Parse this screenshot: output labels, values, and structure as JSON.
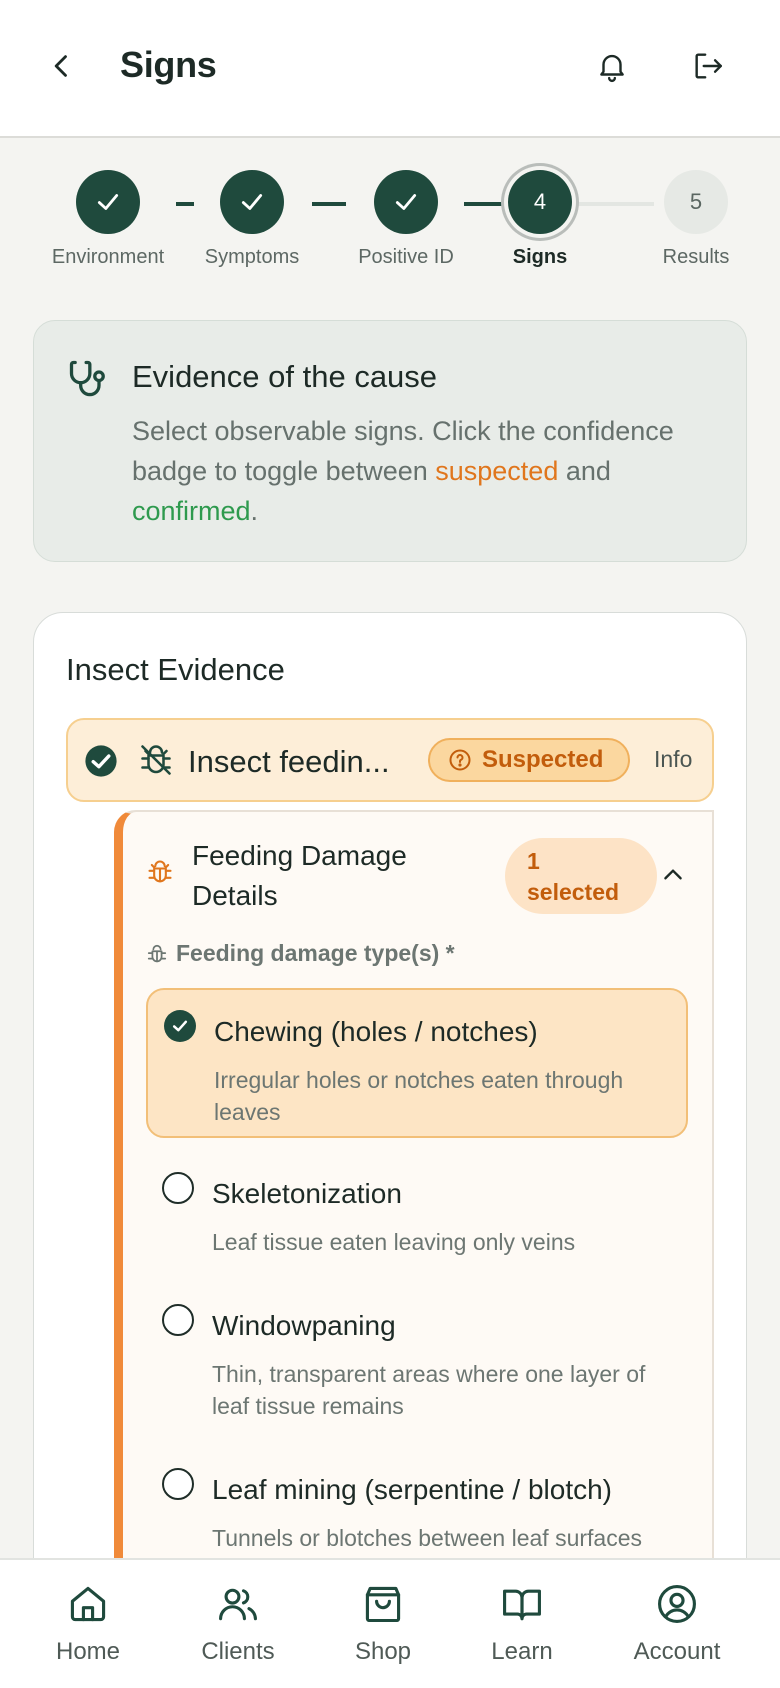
{
  "header": {
    "title": "Signs",
    "back_icon": "chevron-left-icon",
    "notification_icon": "bell-icon",
    "logout_icon": "logout-icon"
  },
  "stepper": {
    "steps": [
      {
        "label": "Environment",
        "state": "done",
        "number": ""
      },
      {
        "label": "Symptoms",
        "state": "done",
        "number": ""
      },
      {
        "label": "Positive ID",
        "state": "done",
        "number": ""
      },
      {
        "label": "Signs",
        "state": "current",
        "number": "4"
      },
      {
        "label": "Results",
        "state": "todo",
        "number": "5"
      }
    ]
  },
  "info": {
    "heading": "Evidence of the cause",
    "desc_before": "Select observable signs. Click the confidence badge to toggle between ",
    "suspected": "suspected",
    "and": " and ",
    "confirmed": "confirmed",
    "period": "."
  },
  "panel": {
    "title": "Insect Evidence",
    "evidence": {
      "label": "Insect feedin...",
      "badge": "Suspected",
      "info_link": "Info"
    },
    "details": {
      "title": "Feeding Damage Details",
      "count": "1 selected",
      "field_label": "Feeding damage type(s) *",
      "options": [
        {
          "name": "Chewing (holes / notches)",
          "desc": "Irregular holes or notches eaten through leaves",
          "selected": true
        },
        {
          "name": "Skeletonization",
          "desc": "Leaf tissue eaten leaving only veins",
          "selected": false
        },
        {
          "name": "Windowpaning",
          "desc": "Thin, transparent areas where one layer of leaf tissue remains",
          "selected": false
        },
        {
          "name": "Leaf mining (serpentine / blotch)",
          "desc": "Tunnels or blotches between leaf surfaces caused by larvae",
          "selected": false
        }
      ]
    }
  },
  "nav": {
    "items": [
      {
        "label": "Home",
        "icon": "home-icon"
      },
      {
        "label": "Clients",
        "icon": "users-icon"
      },
      {
        "label": "Shop",
        "icon": "shopping-bag-icon"
      },
      {
        "label": "Learn",
        "icon": "book-icon"
      },
      {
        "label": "Account",
        "icon": "account-icon"
      }
    ]
  },
  "colors": {
    "primary": "#1f4a3d",
    "accent_orange": "#f08a3a",
    "suspected": "#e0761d",
    "confirmed": "#2e9a4e"
  }
}
